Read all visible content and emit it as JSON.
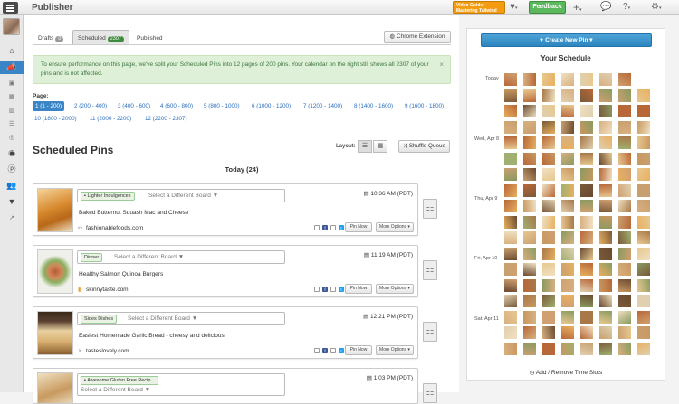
{
  "topbar": {
    "title": "Publisher",
    "video_guide": "Video Guide: Mastering Tailwind",
    "feedback": "Feedback"
  },
  "tabs": [
    {
      "label": "Drafts",
      "count": "0"
    },
    {
      "label": "Scheduled",
      "count": "2307"
    },
    {
      "label": "Published",
      "count": ""
    }
  ],
  "chrome_extension": "Chrome Extension",
  "alert": {
    "text": "To ensure performance on this page, we've split your Scheduled Pins into 12 pages of 200 pins. Your calendar on the right still shows all 2307 of your pins and is not affected.",
    "close": "×"
  },
  "pagination": {
    "label": "Page:",
    "pages": [
      {
        "num": "1",
        "range": "(1 - 200)"
      },
      {
        "num": "2",
        "range": "(200 - 400)"
      },
      {
        "num": "3",
        "range": "(400 - 600)"
      },
      {
        "num": "4",
        "range": "(600 - 800)"
      },
      {
        "num": "5",
        "range": "(800 - 1000)"
      },
      {
        "num": "6",
        "range": "(1000 - 1200)"
      },
      {
        "num": "7",
        "range": "(1200 - 1400)"
      },
      {
        "num": "8",
        "range": "(1400 - 1600)"
      },
      {
        "num": "9",
        "range": "(1600 - 1800)"
      },
      {
        "num": "10",
        "range": "(1800 - 2000)"
      },
      {
        "num": "11",
        "range": "(2000 - 2200)"
      },
      {
        "num": "12",
        "range": "(2200 - 2307)"
      }
    ]
  },
  "section_title": "Scheduled Pins",
  "layout_label": "Layout:",
  "shuffle_label": "Shuffle Queue",
  "day_heading": "Today (24)",
  "select_placeholder": "Select a Different Board ▼",
  "pin_now": "Pin Now",
  "more_options": "More Options ▾",
  "pins": [
    {
      "board": "Lighter Indulgences",
      "time": "10:36 AM (PDT)",
      "desc": "Baked Butternut Squash Mac and Cheese",
      "source": "fashionablefoods.com",
      "thumb_color": "#e0a050"
    },
    {
      "board": "Dinner",
      "time": "11:19 AM (PDT)",
      "desc": "Healthy Salmon Quinoa Burgers",
      "source": "skinnytaste.com",
      "thumb_color": "#c8b89a"
    },
    {
      "board": "Sides Dishes",
      "time": "12:21 PM (PDT)",
      "desc": "Easiest Homemade Garlic Bread - cheesy and delicious!",
      "source": "tasteslovely.com",
      "thumb_color": "#7a5a3a"
    },
    {
      "board": "Awesome Gluten Free Recip...",
      "time": "1:03 PM (PDT)",
      "desc": "",
      "source": "",
      "thumb_color": "#d8c8a8"
    }
  ],
  "right_panel": {
    "create_pin": "+ Create New Pin ▾",
    "title": "Your Schedule",
    "days": [
      "Today",
      "Wed, Apr 8",
      "Thu, Apr 9",
      "Fri, Apr 10",
      "Sat, Apr 11"
    ],
    "time_slots": "Add / Remove Time Slots"
  }
}
